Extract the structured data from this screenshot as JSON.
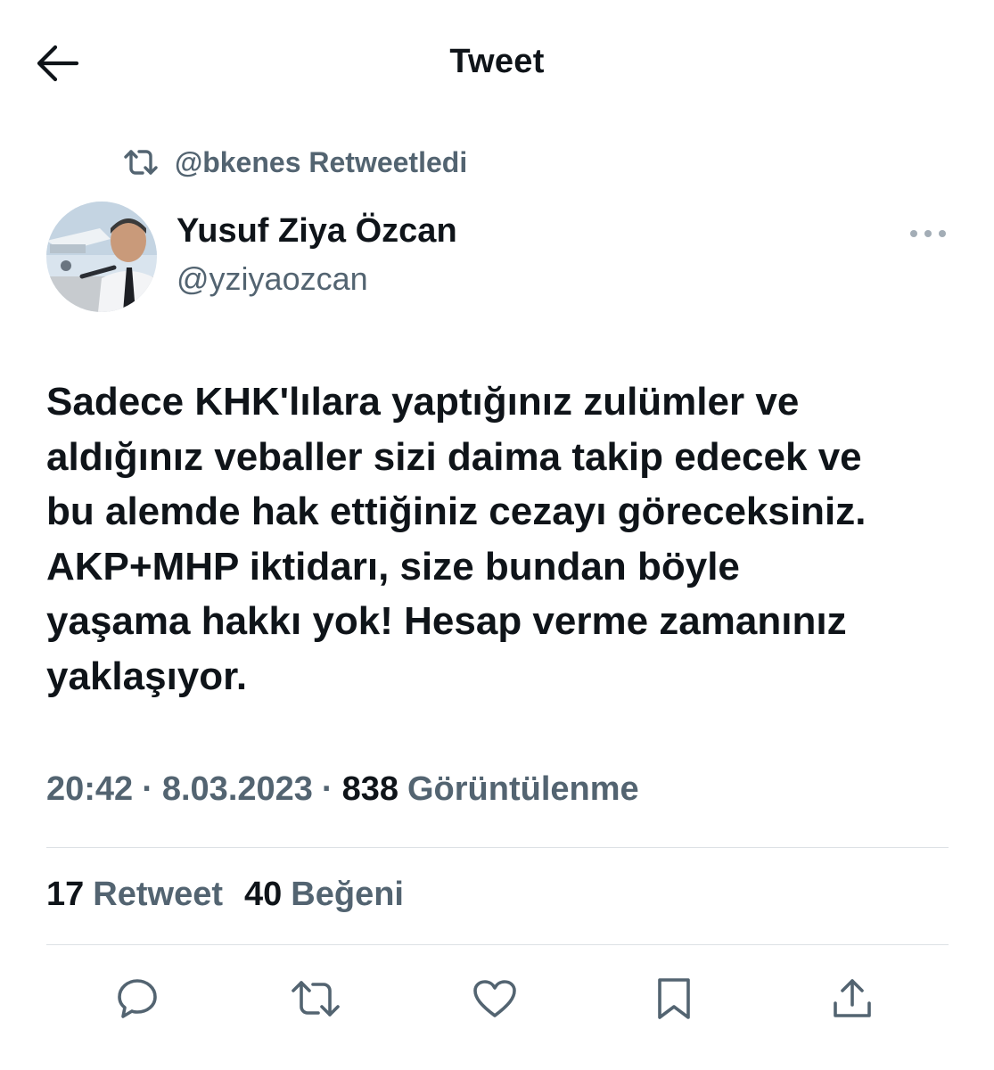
{
  "header": {
    "title": "Tweet",
    "back_icon": "arrow-left-icon"
  },
  "retweet_context": {
    "icon": "retweet-icon",
    "text": "@bkenes Retweetledi"
  },
  "author": {
    "name": "Yusuf Ziya Özcan",
    "handle": "@yziyaozcan",
    "avatar_icon": "avatar-photo",
    "more_icon": "more-horizontal-icon"
  },
  "tweet": {
    "text": "Sadece KHK'lılara yaptığınız zulümler ve\naldığınız veballer sizi daima takip edecek ve\nbu alemde hak ettiğiniz cezayı göreceksiniz.\nAKP+MHP iktidarı, size bundan böyle\nyaşama hakkı yok! Hesap verme zamanınız\nyaklaşıyor."
  },
  "meta": {
    "time": "20:42",
    "separator": "·",
    "date": "8.03.2023",
    "views_count": "838",
    "views_label": "Görüntülenme"
  },
  "stats": {
    "retweets_count": "17",
    "retweets_label": "Retweet",
    "likes_count": "40",
    "likes_label": "Beğeni"
  },
  "actions": [
    "reply-icon",
    "retweet-icon",
    "like-icon",
    "bookmark-icon",
    "share-icon"
  ],
  "colors": {
    "text": "#0f1419",
    "secondary": "#536471",
    "divider": "#dde1e5",
    "background": "#ffffff"
  }
}
